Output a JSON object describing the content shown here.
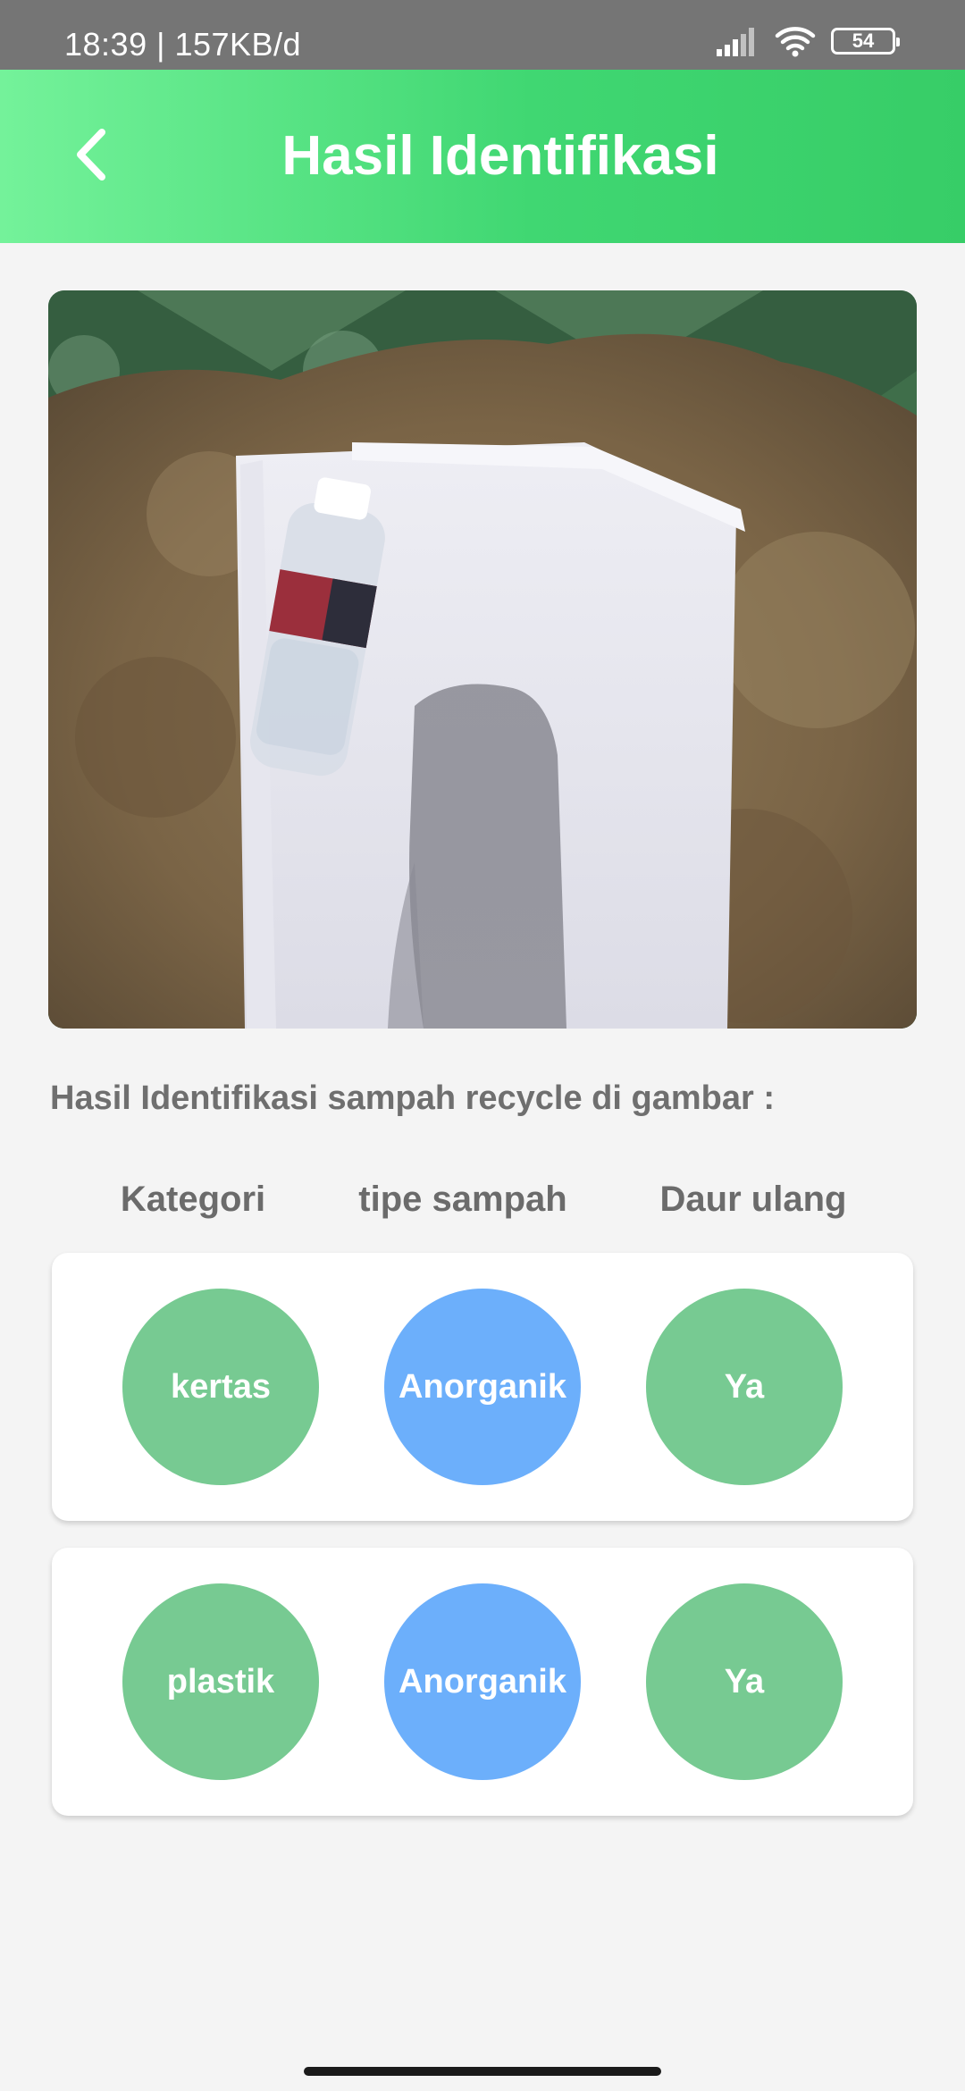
{
  "status_bar": {
    "time_speed": "18:39 | 157KB/d",
    "battery_level": "54",
    "icons": [
      "signal-icon",
      "wifi-icon",
      "battery-icon"
    ]
  },
  "app_bar": {
    "title": "Hasil Identifikasi",
    "back_icon": "chevron-left-icon"
  },
  "result_heading": "Hasil Identifikasi sampah recycle di gambar :",
  "columns": {
    "category": "Kategori",
    "waste_type": "tipe sampah",
    "recycle": "Daur ulang"
  },
  "results": [
    {
      "category": "kertas",
      "waste_type": "Anorganik",
      "recycle": "Ya"
    },
    {
      "category": "plastik",
      "waste_type": "Anorganik",
      "recycle": "Ya"
    }
  ],
  "colors": {
    "app_bar_start": "#74f29a",
    "app_bar_end": "#37cd67",
    "green_badge": "#77ca92",
    "blue_badge": "#6caffb",
    "heading_text": "#6f6f6f"
  }
}
